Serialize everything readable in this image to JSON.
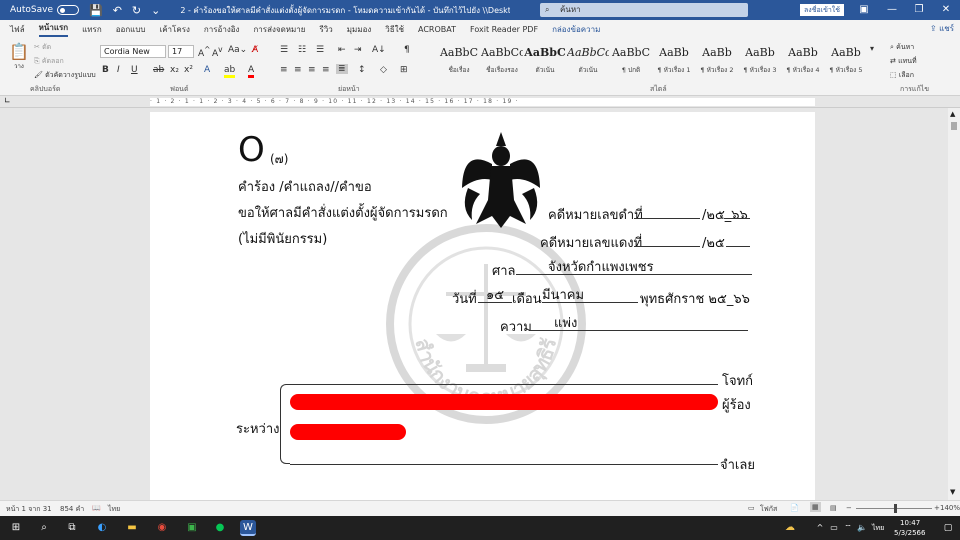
{
  "titlebar": {
    "autosave_label": "AutoSave",
    "autosave_state": "ปิด",
    "title": "2 - คำร้องขอให้ศาลมีคำสั่งแต่งตั้งผู้จัดการมรดก - โหมดความเข้ากันได้ - บันทึกไว้ไปยัง \\\\Desktop-1fo7j9i\\ไฟล์สำนักงาน",
    "search_placeholder": "ค้นหา",
    "signin_label": "ลงชื่อเข้าใช้",
    "minimize": "—",
    "restore": "❐",
    "close": "✕"
  },
  "ribbon_tabs": [
    "ไฟล์",
    "หน้าแรก",
    "แทรก",
    "ออกแบบ",
    "เค้าโครง",
    "การอ้างอิง",
    "การส่งจดหมาย",
    "รีวิว",
    "มุมมอง",
    "วิธีใช้",
    "ACROBAT",
    "Foxit Reader PDF",
    "กล่องข้อความ"
  ],
  "share_label": "แชร์",
  "clipboard": {
    "paste": "วาง",
    "cut": "ตัด",
    "copy": "คัดลอก",
    "format_painter": "ตัวคัดวางรูปแบบ",
    "label": "คลิปบอร์ด"
  },
  "font": {
    "name": "Cordia New",
    "size": "17",
    "label": "ฟอนต์"
  },
  "paragraph_label": "ย่อหน้า",
  "styles_label": "สไตล์",
  "styles": [
    {
      "sample": "AaBbC",
      "name": "ชื่อเรื่อง"
    },
    {
      "sample": "AaBbCcD",
      "name": "ชื่อเรื่องรอง"
    },
    {
      "sample": "AaBbC",
      "name": "ตัวเน้น"
    },
    {
      "sample": "AaBbCc",
      "name": "ตัวเน้น"
    },
    {
      "sample": "AaBbC",
      "name": "¶ ปกติ"
    },
    {
      "sample": "AaBb",
      "name": "¶ หัวเรื่อง 1"
    },
    {
      "sample": "AaBb",
      "name": "¶ หัวเรื่อง 2"
    },
    {
      "sample": "AaBb",
      "name": "¶ หัวเรื่อง 3"
    },
    {
      "sample": "AaBb",
      "name": "¶ หัวเรื่อง 4"
    },
    {
      "sample": "AaBb",
      "name": "¶ หัวเรื่อง 5"
    }
  ],
  "editing": {
    "find": "ค้นหา",
    "replace": "แทนที่",
    "select": "เลือก",
    "label": "การแก้ไข"
  },
  "ruler_text": "· 1 · 2 · 1 · 1 · 2 · 3 · 4 · 5 · 6 · 7 · 8 · 9 · 10 · 11 · 12 · 13 · 14 · 15 · 16 · 17 · 18 · 19 ·",
  "document": {
    "form_letter": "O",
    "form_no": "(๗)",
    "request_title": "คำร้อง /คำแถลง//คำขอ",
    "request_subject": "ขอให้ศาลมีคำสั่งแต่งตั้งผู้จัดการมรดก",
    "no_will": "(ไม่มีพินัยกรรม)",
    "black_case_label": "คดีหมายเลขดำที่",
    "black_case_year": "/๒๕_๖๖",
    "red_case_label": "คดีหมายเลขแดงที่",
    "red_case_year": "/๒๕",
    "court_label": "ศาล",
    "court_value": "จังหวัดกำแพงเพชร",
    "date_label": "วันที่",
    "date_day": "๑๕",
    "month_label": "เดือน",
    "month_value": "มีนาคม",
    "year_label": "พุทธศักราช ๒๕_๖๖",
    "case_type_label": "ความ",
    "case_type_value": "แพ่ง",
    "between_label": "ระหว่าง",
    "plaintiff_label": "โจทก์",
    "petitioner_label": "ผู้ร้อง",
    "defendant_label": "จำเลย",
    "watermark_text": "สำนักงานกฎหมายสุทธิรักษ์"
  },
  "status": {
    "page": "หน้า 1 จาก 31",
    "words": "854 คำ",
    "language": "ไทย",
    "focus": "โฟกัส",
    "zoom": "140%"
  },
  "taskbar": {
    "search_icon": "search-icon",
    "time": "10:47",
    "date": "5/3/2566",
    "lang": "ไทย"
  },
  "colors": {
    "word_blue": "#2b579a",
    "redaction": "#ff0000"
  }
}
